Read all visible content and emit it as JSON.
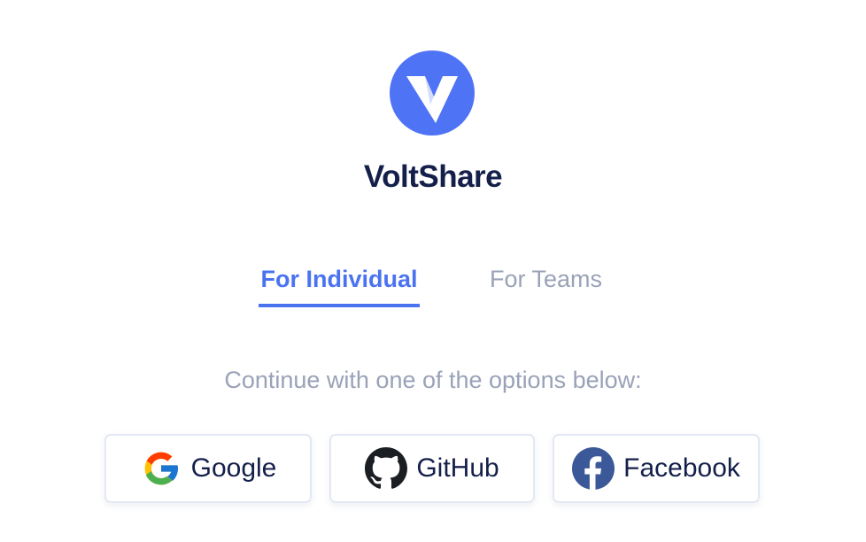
{
  "brand": {
    "name": "VoltShare",
    "logo_color": "#4a73f0"
  },
  "tabs": {
    "individual": "For Individual",
    "teams": "For Teams",
    "active": "individual",
    "accent_color": "#4a73f0"
  },
  "subtitle": "Continue with one of the options below:",
  "providers": [
    {
      "label": "Google",
      "icon": "google-icon"
    },
    {
      "label": "GitHub",
      "icon": "github-icon"
    },
    {
      "label": "Facebook",
      "icon": "facebook-icon"
    }
  ]
}
